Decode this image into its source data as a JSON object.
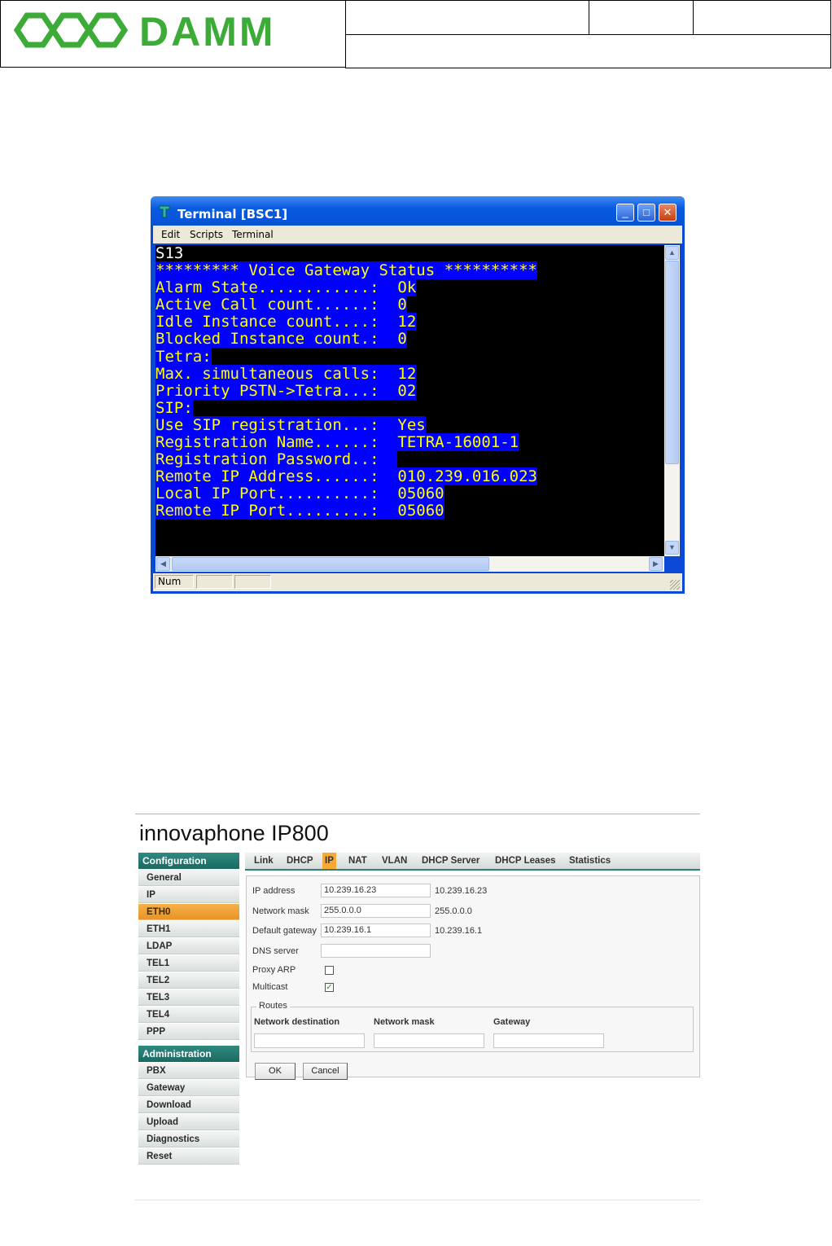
{
  "document_header": {
    "logo_text": "DAMM"
  },
  "terminal": {
    "title": "Terminal [BSC1]",
    "menu": [
      "Edit",
      "Scripts",
      "Terminal"
    ],
    "lines": [
      {
        "text": "S13",
        "highlight": false
      },
      {
        "text": "********* Voice Gateway Status **********",
        "highlight": true
      },
      {
        "text": "Alarm State............:  Ok",
        "highlight": true
      },
      {
        "text": "Active Call count......:  0",
        "highlight": true
      },
      {
        "text": "Idle Instance count....:  12",
        "highlight": true
      },
      {
        "text": "Blocked Instance count.:  0",
        "highlight": true
      },
      {
        "text": "Tetra:",
        "highlight": true
      },
      {
        "text": "Max. simultaneous calls:  12",
        "highlight": true
      },
      {
        "text": "Priority PSTN->Tetra...:  02",
        "highlight": true
      },
      {
        "text": "SIP:",
        "highlight": true
      },
      {
        "text": "Use SIP registration...:  Yes",
        "highlight": true
      },
      {
        "text": "Registration Name......:  TETRA-16001-1",
        "highlight": true
      },
      {
        "text": "Registration Password..:  ",
        "highlight": true
      },
      {
        "text": "Remote IP Address......:  010.239.016.023",
        "highlight": true
      },
      {
        "text": "Local IP Port..........:  05060",
        "highlight": true
      },
      {
        "text": "Remote IP Port.........:  05060",
        "highlight": true
      }
    ],
    "status_bar": [
      "Num",
      "",
      ""
    ]
  },
  "innovaphone": {
    "title": "innovaphone IP800",
    "configuration_header": "Configuration",
    "configuration_items": [
      "General",
      "IP",
      "ETH0",
      "ETH1",
      "LDAP",
      "TEL1",
      "TEL2",
      "TEL3",
      "TEL4",
      "PPP"
    ],
    "active_item": "ETH0",
    "administration_header": "Administration",
    "administration_items": [
      "PBX",
      "Gateway",
      "Download",
      "Upload",
      "Diagnostics",
      "Reset"
    ],
    "tabs": [
      "Link",
      "DHCP",
      "IP",
      "NAT",
      "VLAN",
      "DHCP Server",
      "DHCP Leases",
      "Statistics"
    ],
    "active_tab": "IP",
    "form": {
      "ip_address_label": "IP address",
      "ip_address_value": "10.239.16.23",
      "ip_address_current": "10.239.16.23",
      "network_mask_label": "Network mask",
      "network_mask_value": "255.0.0.0",
      "network_mask_current": "255.0.0.0",
      "default_gateway_label": "Default gateway",
      "default_gateway_value": "10.239.16.1",
      "default_gateway_current": "10.239.16.1",
      "dns_server_label": "DNS server",
      "dns_server_value": "",
      "proxy_arp_label": "Proxy ARP",
      "proxy_arp_checked": false,
      "multicast_label": "Multicast",
      "multicast_checked": true,
      "routes_legend": "Routes",
      "routes_columns": [
        "Network destination",
        "Network mask",
        "Gateway"
      ],
      "ok_label": "OK",
      "cancel_label": "Cancel"
    }
  }
}
